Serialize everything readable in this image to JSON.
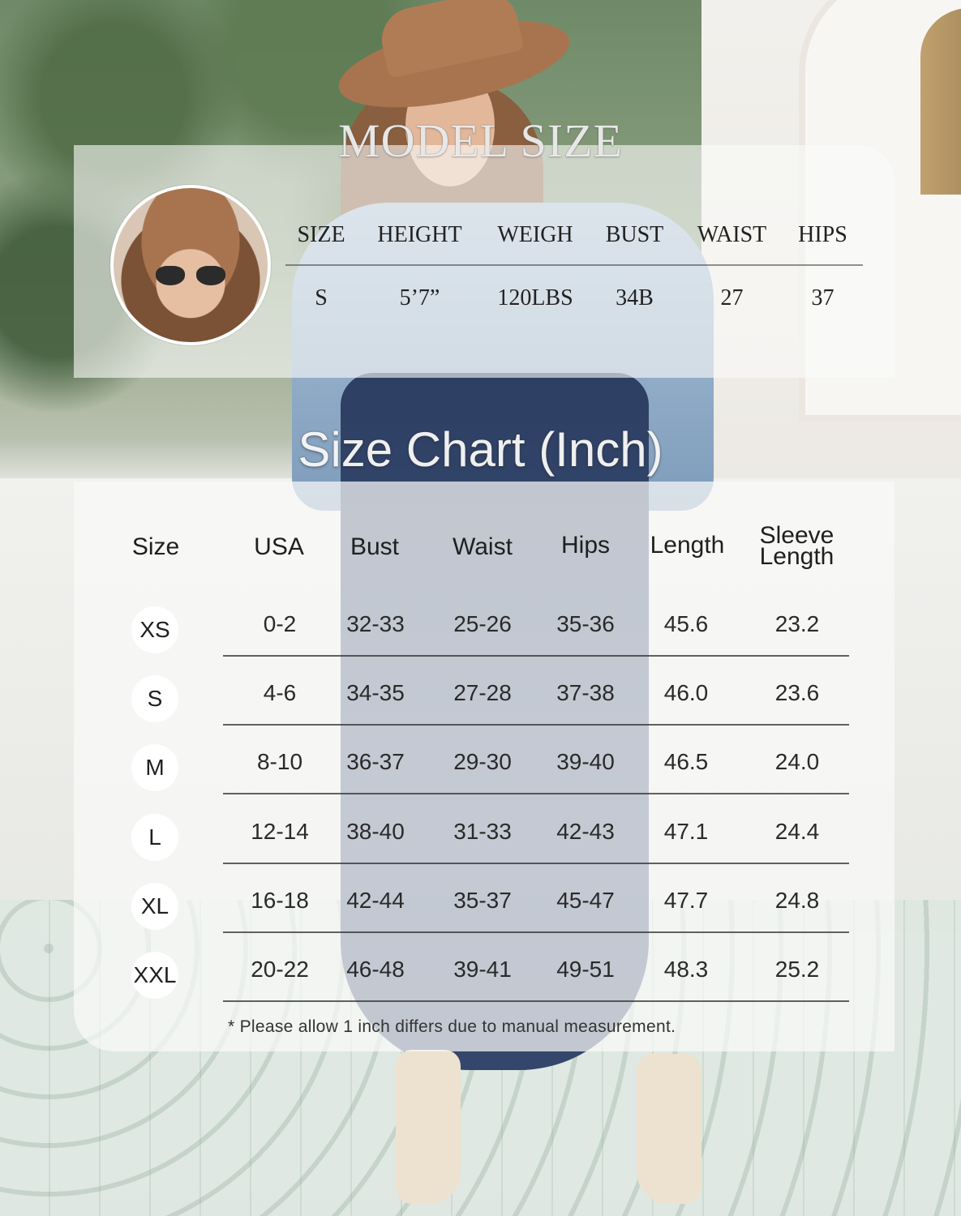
{
  "model_size": {
    "title": "MODEL SIZE",
    "headers": [
      "SIZE",
      "HEIGHT",
      "WEIGH",
      "BUST",
      "WAIST",
      "HIPS"
    ],
    "values": [
      "S",
      "5’7”",
      "120LBS",
      "34B",
      "27",
      "37"
    ]
  },
  "size_chart": {
    "title": "Size Chart (Inch)",
    "headers": [
      "Size",
      "USA",
      "Bust",
      "Waist",
      "Hips",
      "Length",
      "Sleeve",
      "Length"
    ],
    "rows": [
      {
        "size": "XS",
        "usa": "0-2",
        "bust": "32-33",
        "waist": "25-26",
        "hips": "35-36",
        "length": "45.6",
        "sleeve": "23.2"
      },
      {
        "size": "S",
        "usa": "4-6",
        "bust": "34-35",
        "waist": "27-28",
        "hips": "37-38",
        "length": "46.0",
        "sleeve": "23.6"
      },
      {
        "size": "M",
        "usa": "8-10",
        "bust": "36-37",
        "waist": "29-30",
        "hips": "39-40",
        "length": "46.5",
        "sleeve": "24.0"
      },
      {
        "size": "L",
        "usa": "12-14",
        "bust": "38-40",
        "waist": "31-33",
        "hips": "42-43",
        "length": "47.1",
        "sleeve": "24.4"
      },
      {
        "size": "XL",
        "usa": "16-18",
        "bust": "42-44",
        "waist": "35-37",
        "hips": "45-47",
        "length": "47.7",
        "sleeve": "24.8"
      },
      {
        "size": "XXL",
        "usa": "20-22",
        "bust": "46-48",
        "waist": "39-41",
        "hips": "49-51",
        "length": "48.3",
        "sleeve": "25.2"
      }
    ],
    "note": "* Please allow 1 inch differs due to manual measurement."
  }
}
